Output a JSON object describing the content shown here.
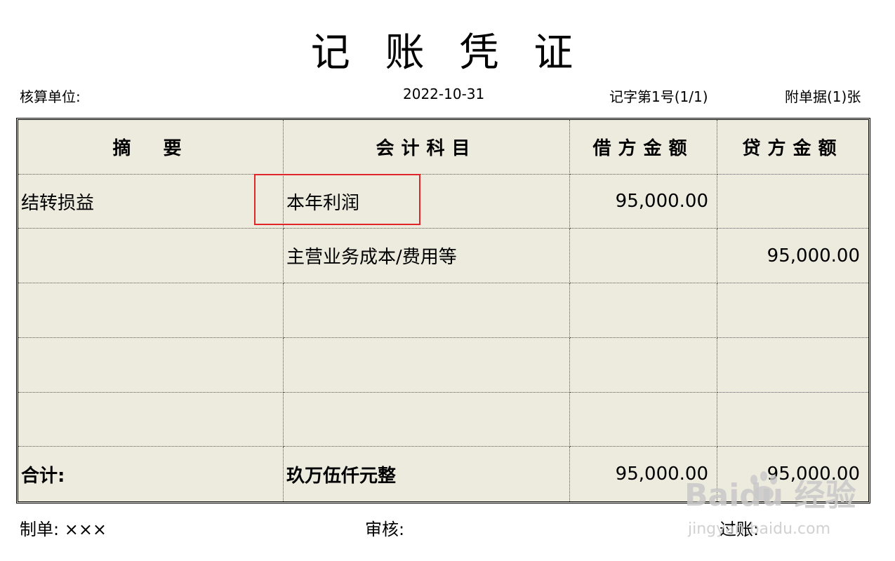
{
  "document": {
    "title": "记 账 凭 证",
    "unit_label": "核算单位:",
    "date": "2022-10-31",
    "voucher_no": "记字第1号(1/1)",
    "attachments": "附单据(1)张"
  },
  "table": {
    "headers": [
      "摘　要",
      "会计科目",
      "借方金额",
      "贷方金额"
    ],
    "rows": [
      {
        "summary": "结转损益",
        "account": "本年利润",
        "debit": "95,000.00",
        "credit": ""
      },
      {
        "summary": "",
        "account": "主营业务成本/费用等",
        "debit": "",
        "credit": "95,000.00"
      },
      {
        "summary": "",
        "account": "",
        "debit": "",
        "credit": ""
      },
      {
        "summary": "",
        "account": "",
        "debit": "",
        "credit": ""
      },
      {
        "summary": "",
        "account": "",
        "debit": "",
        "credit": ""
      }
    ],
    "total": {
      "label": "合计:",
      "amount_words": "玖万伍仟元整",
      "debit": "95,000.00",
      "credit": "95,000.00"
    }
  },
  "footer": {
    "prepared_by": "制单: ×××",
    "reviewed_by": "审核:",
    "posted_by": "过账:"
  },
  "watermark": {
    "brand": "Baidu 经验",
    "url": "jingyan.baidu.com"
  },
  "colors": {
    "sheet_background": "#edeade",
    "highlight_border": "#e0252b"
  }
}
